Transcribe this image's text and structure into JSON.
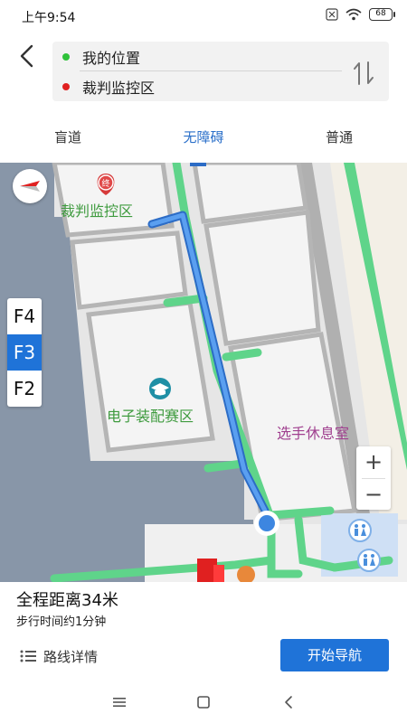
{
  "status_bar": {
    "time": "上午9:54",
    "battery": "68",
    "icons": [
      "close-box-icon",
      "wifi-icon",
      "battery-icon"
    ]
  },
  "route": {
    "start": "我的位置",
    "destination": "裁判监控区",
    "start_color": "#2fc23a",
    "destination_color": "#e02020",
    "icons": [
      "back-arrow-icon",
      "swap-icon"
    ]
  },
  "tabs": [
    {
      "label": "盲道",
      "active": false
    },
    {
      "label": "无障碍",
      "active": true
    },
    {
      "label": "普通",
      "active": false
    }
  ],
  "map": {
    "floors": [
      "F4",
      "F3",
      "F2"
    ],
    "active_floor": "F3",
    "zoom_in_label": "+",
    "zoom_out_label": "−",
    "labels": {
      "referee_area": "裁判监控区",
      "electronics_area": "电子装配赛区",
      "rest_room": "选手休息室"
    },
    "destination_marker": "终",
    "colors": {
      "route": "#3d86e0",
      "accessible_path": "#5fd48a",
      "building": "#8896a8",
      "room": "#f2f2f2",
      "wall": "#b5b5b5"
    },
    "icons": [
      "compass-icon",
      "graduation-cap-icon",
      "restroom-icon",
      "location-dot-icon"
    ]
  },
  "summary": {
    "distance": "全程距离34米",
    "walk_time": "步行时间约1分钟",
    "details_label": "路线详情",
    "start_button": "开始导航"
  },
  "nav_bar": {
    "icons": [
      "menu-icon",
      "home-square-icon",
      "back-chevron-icon"
    ]
  }
}
